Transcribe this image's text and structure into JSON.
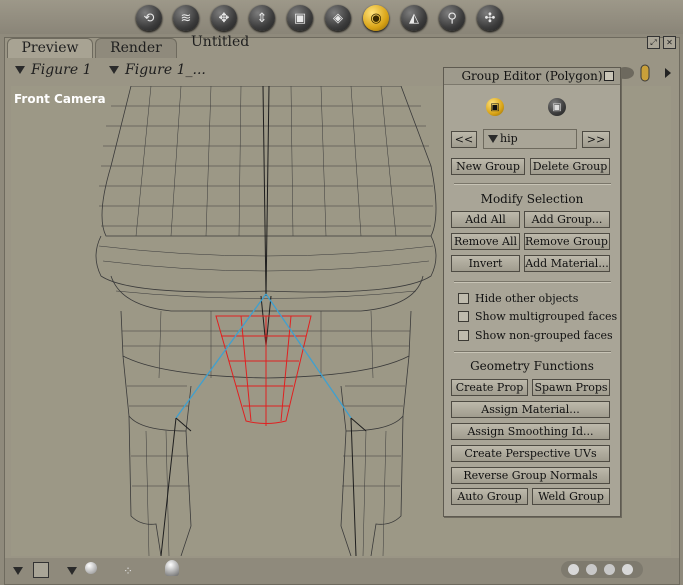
{
  "toolbar": {
    "tools": [
      "rotate-icon",
      "twist-icon",
      "translate-icon",
      "scale-icon",
      "taper-icon",
      "morph-icon",
      "group-icon",
      "direct-manipulation-icon",
      "magnify-icon",
      "view-magnifier-icon"
    ],
    "active": "group-icon"
  },
  "doc": {
    "tabs": {
      "preview": "Preview",
      "render": "Render"
    },
    "title": "Untitled"
  },
  "figures": {
    "figure": "Figure 1",
    "element": "Figure 1_..."
  },
  "viewport": {
    "camera_label": "Front Camera"
  },
  "group_editor": {
    "title": "Group Editor  (Polygon)",
    "group_name": "hip",
    "prev": "<<",
    "next": ">>",
    "new_group": "New Group",
    "delete_group": "Delete Group",
    "modify_selection_header": "Modify Selection",
    "add_all": "Add All",
    "add_group": "Add Group...",
    "remove_all": "Remove All",
    "remove_group": "Remove Group...",
    "invert": "Invert",
    "add_material": "Add Material...",
    "hide_other_objects": "Hide other objects",
    "show_multigrouped": "Show multigrouped faces",
    "show_nongrouped": "Show non-grouped faces",
    "geometry_header": "Geometry Functions",
    "create_prop": "Create Prop",
    "spawn_props": "Spawn Props",
    "assign_material": "Assign Material...",
    "assign_smoothing": "Assign Smoothing Id...",
    "create_uvs": "Create Perspective UVs",
    "reverse_normals": "Reverse Group Normals",
    "auto_group": "Auto Group",
    "weld_group": "Weld Group"
  },
  "colors": {
    "background": "#9c9886",
    "wireframe": "#3a3a3a",
    "selected_faces": "#e02020",
    "bones": "#3ea0d0",
    "active_tool": "#d9a417"
  }
}
